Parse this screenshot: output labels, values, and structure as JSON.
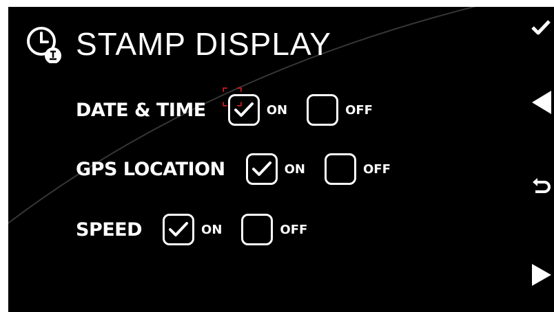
{
  "header": {
    "title": "STAMP DISPLAY",
    "icon": "clock-stamp-icon"
  },
  "settings": [
    {
      "label": "DATE & TIME",
      "on_label": "ON",
      "off_label": "OFF",
      "on_checked": true,
      "focused": true
    },
    {
      "label": "GPS LOCATION",
      "on_label": "ON",
      "off_label": "OFF",
      "on_checked": true,
      "focused": false
    },
    {
      "label": "SPEED",
      "on_label": "ON",
      "off_label": "OFF",
      "on_checked": true,
      "focused": false
    }
  ],
  "side_controls": [
    "check-icon",
    "left-arrow-icon",
    "back-icon",
    "right-arrow-icon"
  ],
  "colors": {
    "background": "#000000",
    "foreground": "#ffffff",
    "focus": "#e0201c"
  }
}
